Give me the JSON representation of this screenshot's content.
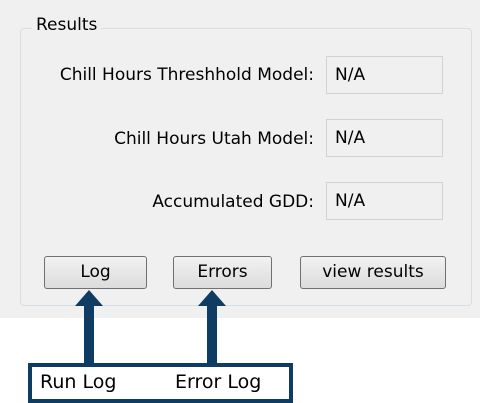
{
  "group": {
    "title": "Results"
  },
  "rows": [
    {
      "label": "Chill Hours Threshhold Model:",
      "value": "N/A"
    },
    {
      "label": "Chill Hours Utah Model:",
      "value": "N/A"
    },
    {
      "label": "Accumulated GDD:",
      "value": "N/A"
    }
  ],
  "buttons": {
    "log": "Log",
    "errors": "Errors",
    "view_results": "view results"
  },
  "annotation": {
    "run_log": "Run Log",
    "error_log": "Error Log",
    "color": "#0f3c63"
  }
}
